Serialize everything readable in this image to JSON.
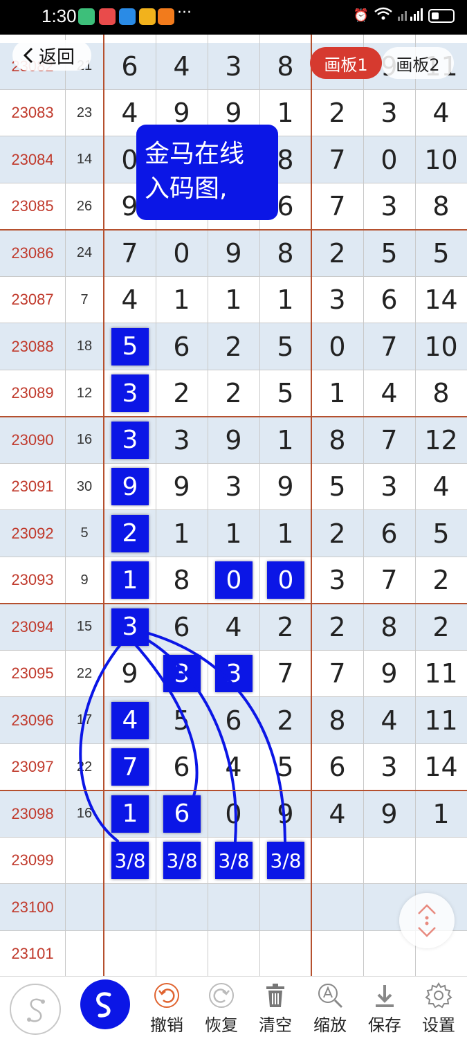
{
  "status_bar": {
    "time": "1:30",
    "more": "···",
    "network": "4G"
  },
  "nav": {
    "back_label": "返回",
    "tabs": [
      {
        "label": "画板1",
        "active": true
      },
      {
        "label": "画板2",
        "active": false
      }
    ]
  },
  "annotation_text_line1": "金马在线",
  "annotation_text_line2": "入码图,",
  "rows": [
    {
      "issue": "23082",
      "sum": "21",
      "digits": [
        "6",
        "4",
        "3",
        "8",
        "8",
        "9",
        "11"
      ]
    },
    {
      "issue": "23083",
      "sum": "23",
      "digits": [
        "4",
        "9",
        "9",
        "1",
        "2",
        "3",
        "4"
      ]
    },
    {
      "issue": "23084",
      "sum": "14",
      "digits": [
        "0",
        "",
        "",
        "8",
        "7",
        "0",
        "10"
      ]
    },
    {
      "issue": "23085",
      "sum": "26",
      "digits": [
        "9",
        "",
        "",
        "6",
        "7",
        "3",
        "8"
      ]
    },
    {
      "issue": "23086",
      "sum": "24",
      "digits": [
        "7",
        "0",
        "9",
        "8",
        "2",
        "5",
        "5"
      ]
    },
    {
      "issue": "23087",
      "sum": "7",
      "digits": [
        "4",
        "1",
        "1",
        "1",
        "3",
        "6",
        "14"
      ]
    },
    {
      "issue": "23088",
      "sum": "18",
      "digits": [
        "5",
        "6",
        "2",
        "5",
        "0",
        "7",
        "10"
      ]
    },
    {
      "issue": "23089",
      "sum": "12",
      "digits": [
        "3",
        "2",
        "2",
        "5",
        "1",
        "4",
        "8"
      ]
    },
    {
      "issue": "23090",
      "sum": "16",
      "digits": [
        "3",
        "3",
        "9",
        "1",
        "8",
        "7",
        "12"
      ]
    },
    {
      "issue": "23091",
      "sum": "30",
      "digits": [
        "9",
        "9",
        "3",
        "9",
        "5",
        "3",
        "4"
      ]
    },
    {
      "issue": "23092",
      "sum": "5",
      "digits": [
        "2",
        "1",
        "1",
        "1",
        "2",
        "6",
        "5"
      ]
    },
    {
      "issue": "23093",
      "sum": "9",
      "digits": [
        "1",
        "8",
        "0",
        "0",
        "3",
        "7",
        "2"
      ]
    },
    {
      "issue": "23094",
      "sum": "15",
      "digits": [
        "3",
        "6",
        "4",
        "2",
        "2",
        "8",
        "2"
      ]
    },
    {
      "issue": "23095",
      "sum": "22",
      "digits": [
        "9",
        "3",
        "3",
        "7",
        "7",
        "9",
        "11"
      ]
    },
    {
      "issue": "23096",
      "sum": "17",
      "digits": [
        "4",
        "5",
        "6",
        "2",
        "8",
        "4",
        "11"
      ]
    },
    {
      "issue": "23097",
      "sum": "22",
      "digits": [
        "7",
        "6",
        "4",
        "5",
        "6",
        "3",
        "14"
      ]
    },
    {
      "issue": "23098",
      "sum": "16",
      "digits": [
        "1",
        "6",
        "0",
        "9",
        "4",
        "9",
        "1"
      ]
    },
    {
      "issue": "23099",
      "sum": "",
      "digits": [
        "3/8",
        "3/8",
        "3/8",
        "3/8",
        "",
        "",
        ""
      ]
    },
    {
      "issue": "23100",
      "sum": "",
      "digits": [
        "",
        "",
        "",
        "",
        "",
        "",
        ""
      ]
    },
    {
      "issue": "23101",
      "sum": "",
      "digits": [
        "",
        "",
        "",
        "",
        "",
        "",
        ""
      ]
    }
  ],
  "highlights": [
    {
      "row": 6,
      "col": 0
    },
    {
      "row": 7,
      "col": 0
    },
    {
      "row": 8,
      "col": 0
    },
    {
      "row": 9,
      "col": 0
    },
    {
      "row": 10,
      "col": 0
    },
    {
      "row": 11,
      "col": 0
    },
    {
      "row": 11,
      "col": 2
    },
    {
      "row": 11,
      "col": 3
    },
    {
      "row": 12,
      "col": 0
    },
    {
      "row": 13,
      "col": 1
    },
    {
      "row": 13,
      "col": 2
    },
    {
      "row": 14,
      "col": 0
    },
    {
      "row": 15,
      "col": 0
    },
    {
      "row": 16,
      "col": 0
    },
    {
      "row": 16,
      "col": 1
    },
    {
      "row": 17,
      "col": 0
    },
    {
      "row": 17,
      "col": 1
    },
    {
      "row": 17,
      "col": 2
    },
    {
      "row": 17,
      "col": 3
    }
  ],
  "toolbar": {
    "undo": "撤销",
    "redo": "恢复",
    "clear": "清空",
    "zoom": "缩放",
    "save": "保存",
    "settings": "设置"
  },
  "colors": {
    "accent": "#0b16e6",
    "issue_red": "#c0392b",
    "tab_red": "#d63a2f",
    "row_alt": "#dfe9f3"
  }
}
